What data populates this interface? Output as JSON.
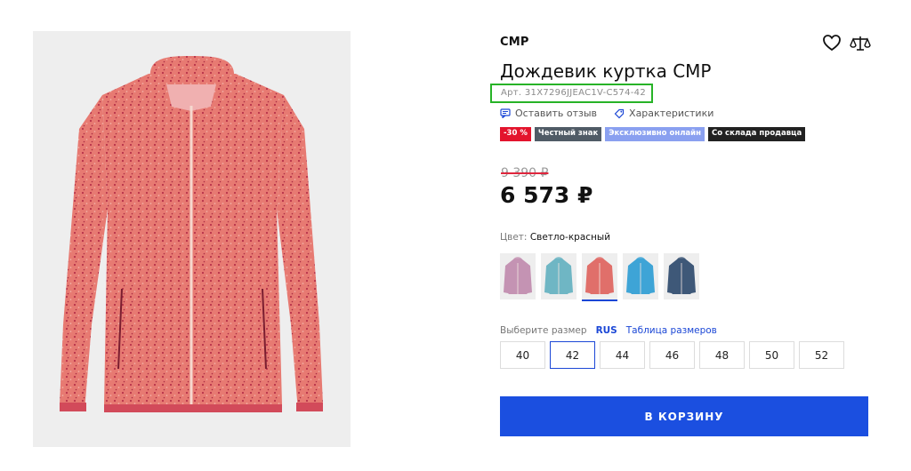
{
  "product": {
    "brand": "CMP",
    "title": "Дождевик куртка CMP",
    "sku": "Арт. 31X7296JJEAC1V-C574-42",
    "main_image": "jacket-coral-photo"
  },
  "actions": {
    "review_label": "Оставить отзыв",
    "review_icon": "comment-icon",
    "specs_label": "Характеристики",
    "specs_icon": "tag-icon",
    "favorite_icon": "heart-icon",
    "compare_icon": "scales-icon"
  },
  "badges": [
    {
      "label": "-30 %",
      "color": "#e3142d"
    },
    {
      "label": "Честный знак",
      "color": "#505b66"
    },
    {
      "label": "Эксклюзивно онлайн",
      "color": "#8aa0f0"
    },
    {
      "label": "Со склада продавца",
      "color": "#222222"
    }
  ],
  "pricing": {
    "old_price": "9 390 ₽",
    "price": "6 573 ₽"
  },
  "color": {
    "label": "Цвет:",
    "value": "Светло-красный",
    "swatches": [
      {
        "name": "lilac",
        "color": "#c493b3",
        "selected": false
      },
      {
        "name": "turquoise",
        "color": "#6fb6c4",
        "selected": false
      },
      {
        "name": "light-red",
        "color": "#e06f6a",
        "selected": true
      },
      {
        "name": "sky-blue",
        "color": "#3ea4d6",
        "selected": false
      },
      {
        "name": "navy",
        "color": "#3e5878",
        "selected": false
      }
    ]
  },
  "size": {
    "label": "Выберите размер",
    "system": "RUS",
    "table_link": "Таблица размеров",
    "options": [
      "40",
      "42",
      "44",
      "46",
      "48",
      "50",
      "52"
    ],
    "selected": "42"
  },
  "cart_button": "В КОРЗИНУ"
}
